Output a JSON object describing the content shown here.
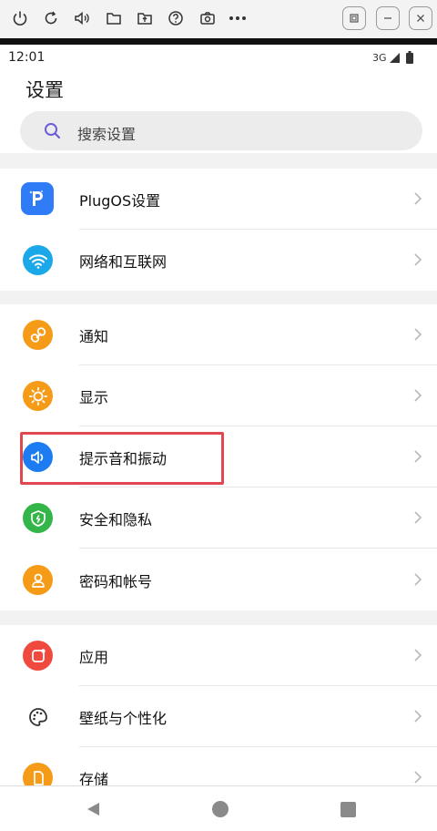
{
  "toolbar": {
    "left_icons": [
      "power-icon",
      "rotate-icon",
      "volume-icon",
      "folder-icon",
      "folder-open-icon",
      "help-icon",
      "screenshot-icon",
      "more-icon"
    ],
    "right_icons": [
      "restore-icon",
      "minimize-icon",
      "close-icon"
    ]
  },
  "status_bar": {
    "time": "12:01",
    "network": "3G"
  },
  "header": {
    "title": "设置"
  },
  "search": {
    "placeholder": "搜索设置"
  },
  "settings": [
    {
      "label": "PlugOS设置",
      "icon": "plugos-icon",
      "color": "#2f7cf6"
    },
    {
      "label": "网络和互联网",
      "icon": "wifi-icon",
      "color": "#1ba8e8"
    },
    {
      "label": "通知",
      "icon": "notification-icon",
      "color": "#f59b17"
    },
    {
      "label": "显示",
      "icon": "sun-icon",
      "color": "#f59b17"
    },
    {
      "label": "提示音和振动",
      "icon": "speaker-icon",
      "color": "#1d7cf2"
    },
    {
      "label": "安全和隐私",
      "icon": "shield-icon",
      "color": "#34b549"
    },
    {
      "label": "密码和帐号",
      "icon": "account-icon",
      "color": "#f59b17"
    },
    {
      "label": "应用",
      "icon": "apps-icon",
      "color": "#f04a3e"
    },
    {
      "label": "壁纸与个性化",
      "icon": "palette-icon",
      "color": "#333333"
    },
    {
      "label": "存储",
      "icon": "storage-icon",
      "color": "#f59b17"
    }
  ],
  "nav": {
    "icons": [
      "back-icon",
      "home-icon",
      "recents-icon"
    ]
  }
}
